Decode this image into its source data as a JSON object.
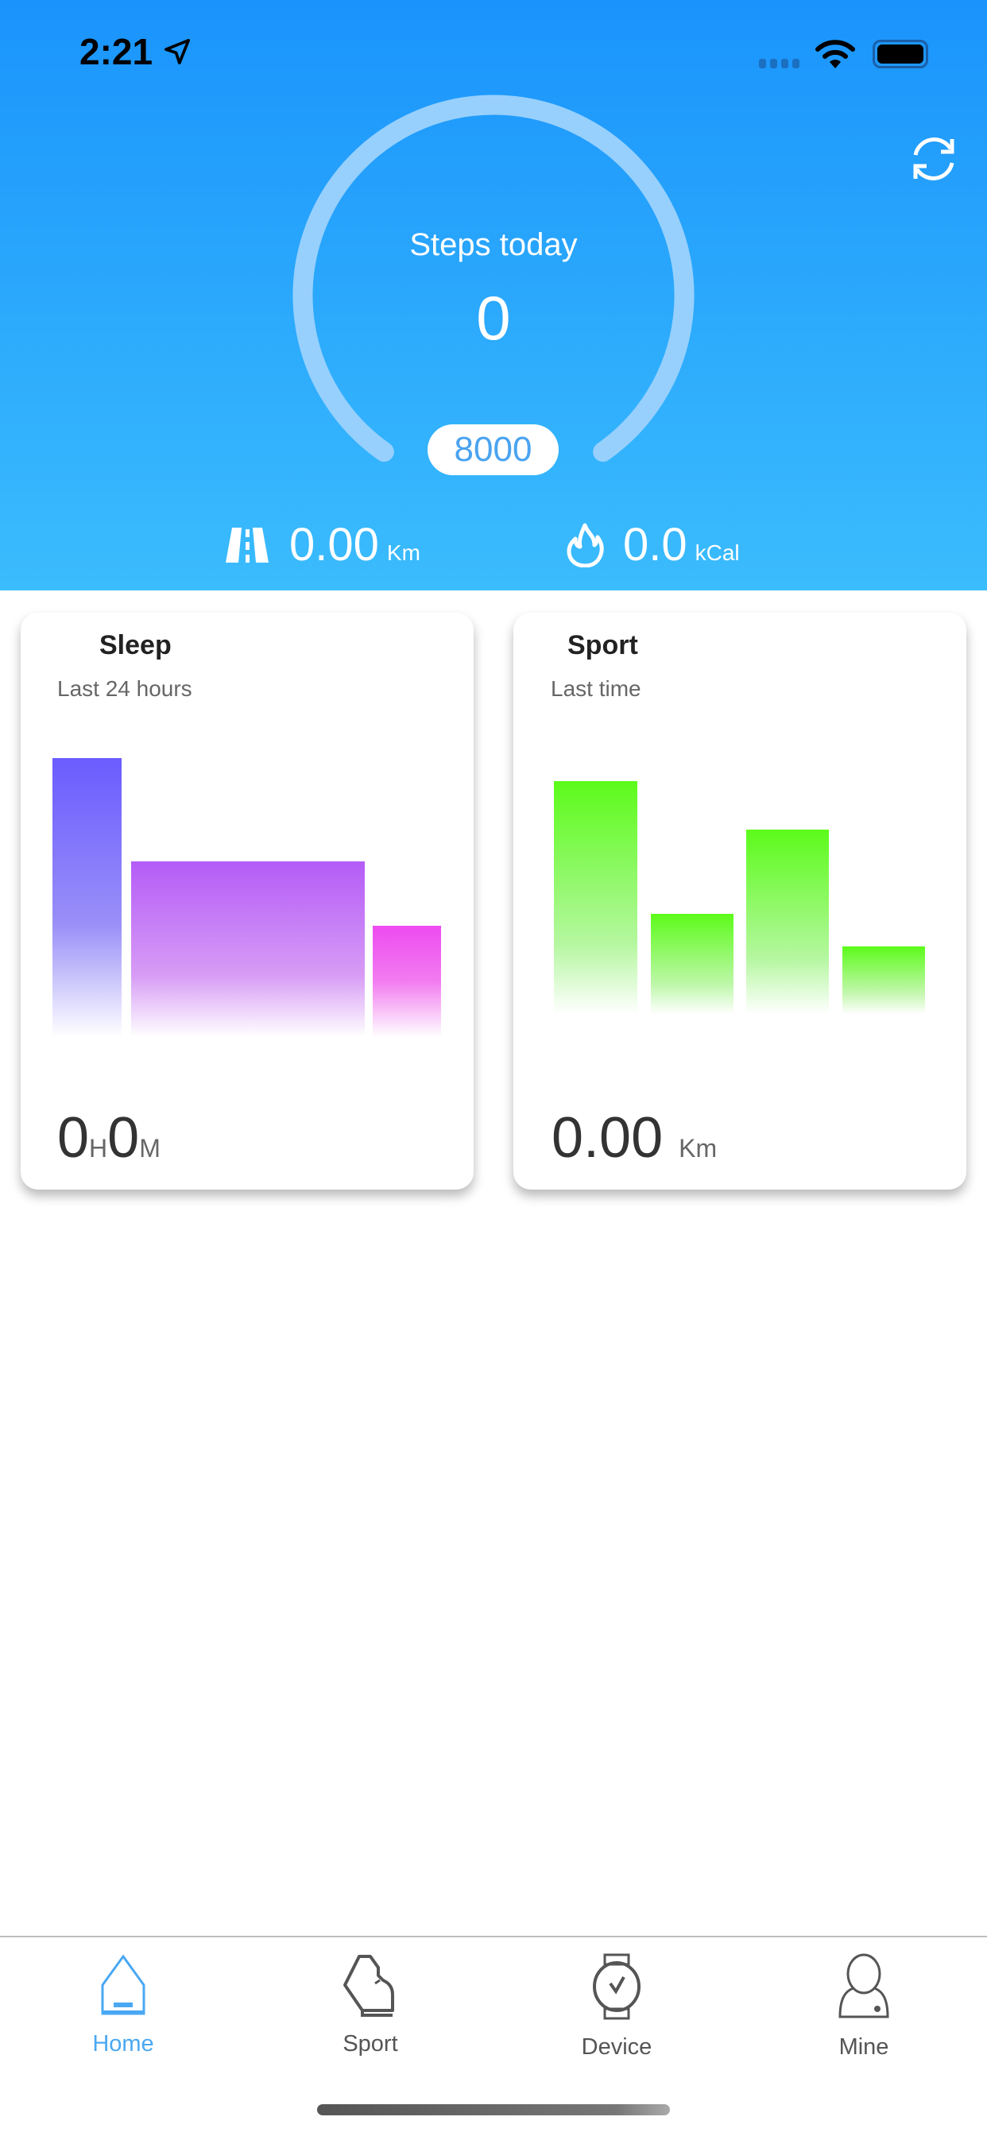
{
  "status_bar": {
    "time": "2:21"
  },
  "header": {
    "steps_label": "Steps today",
    "steps_value": "0",
    "steps_goal": "8000",
    "progress_fraction": 0,
    "distance": {
      "value": "0.00",
      "unit": "Km",
      "icon": "road-icon"
    },
    "calories": {
      "value": "0.0",
      "unit": "kCal",
      "icon": "flame-icon"
    },
    "refresh_icon": "refresh-icon"
  },
  "sleep_card": {
    "title": "Sleep",
    "subtitle": "Last 24 hours",
    "hours": "0",
    "hours_unit": "H",
    "minutes": "0",
    "minutes_unit": "M"
  },
  "sport_card": {
    "title": "Sport",
    "subtitle": "Last time",
    "distance": "0.00",
    "unit": "Km"
  },
  "tabbar": {
    "items": [
      {
        "label": "Home",
        "icon": "home-icon",
        "active": true
      },
      {
        "label": "Sport",
        "icon": "shoe-icon",
        "active": false
      },
      {
        "label": "Device",
        "icon": "watch-icon",
        "active": false
      },
      {
        "label": "Mine",
        "icon": "user-icon",
        "active": false
      }
    ]
  },
  "colors": {
    "accent": "#1a94fc",
    "active_tab": "#4aa8f2",
    "sleep_deep": "#6a5cff",
    "sleep_light": "#b45cf7",
    "sleep_awake": "#ee4bf0",
    "sport_green": "#5cfb1a"
  }
}
